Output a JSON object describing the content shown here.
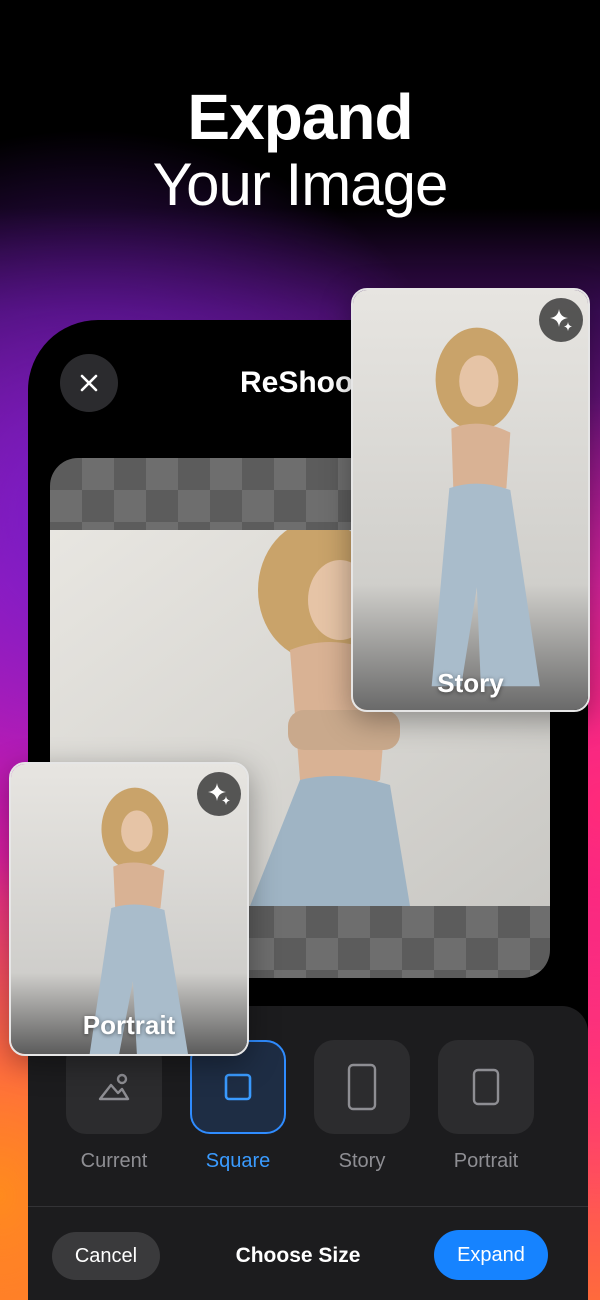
{
  "promo": {
    "headline_bold": "Expand",
    "headline_regular": "Your Image"
  },
  "app": {
    "title": "ReShoot",
    "close_icon": "close-icon"
  },
  "size_options": [
    {
      "label": "Current",
      "icon": "landscape-photo-icon",
      "selected": false
    },
    {
      "label": "Square",
      "icon": "square-frame-icon",
      "selected": true
    },
    {
      "label": "Story",
      "icon": "tall-rectangle-icon",
      "selected": false
    },
    {
      "label": "Portrait",
      "icon": "portrait-rectangle-icon",
      "selected": false
    }
  ],
  "bottom_bar": {
    "cancel_label": "Cancel",
    "title": "Choose Size",
    "expand_label": "Expand"
  },
  "preview_cards": {
    "story_label": "Story",
    "portrait_label": "Portrait",
    "badge_icon": "sparkle-icon"
  },
  "colors": {
    "accent": "#1683ff",
    "selected_text": "#3a9bff",
    "panel_bg": "#1c1c1e"
  }
}
